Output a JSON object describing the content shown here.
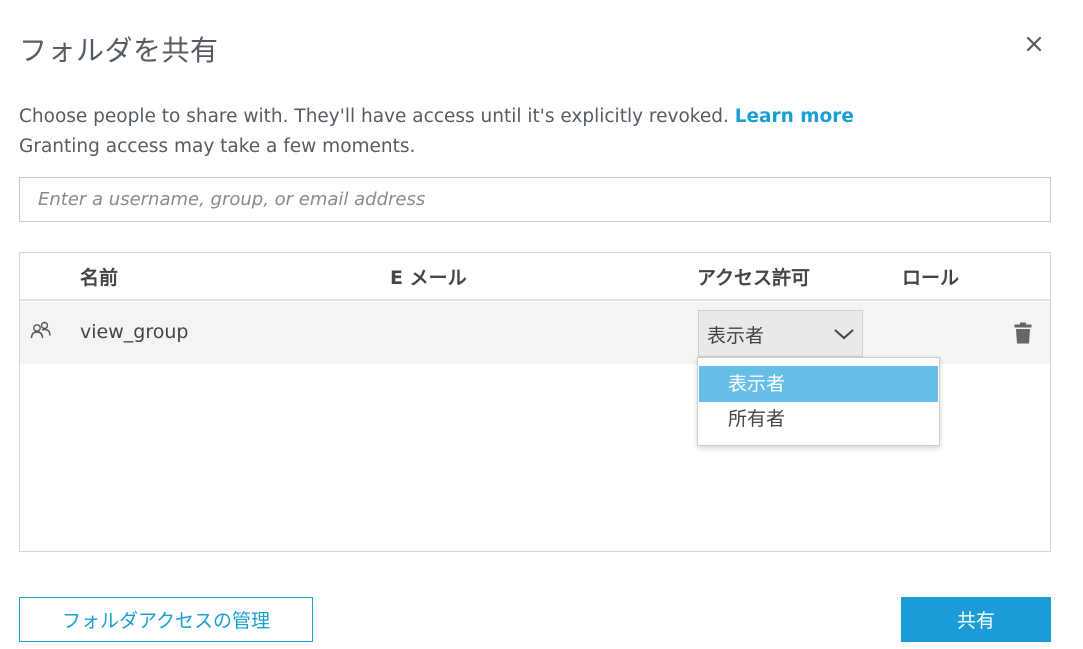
{
  "dialog": {
    "title": "フォルダを共有",
    "close_icon": "close-icon"
  },
  "description": {
    "line1": "Choose people to share with. They'll have access until it's explicitly revoked.",
    "learn_more": "Learn more",
    "line2": "Granting access may take a few moments."
  },
  "search": {
    "value": "",
    "placeholder": "Enter a username, group, or email address"
  },
  "table": {
    "headers": {
      "name": "名前",
      "email": "E メール",
      "access": "アクセス許可",
      "role": "ロール"
    },
    "rows": [
      {
        "icon": "group-icon",
        "name": "view_group",
        "email": "",
        "access": "表示者",
        "role": "",
        "delete_icon": "trash-icon"
      }
    ]
  },
  "access_dropdown": {
    "options": [
      "表示者",
      "所有者"
    ],
    "selected": "表示者"
  },
  "footer": {
    "manage_label": "フォルダアクセスの管理",
    "share_label": "共有"
  },
  "colors": {
    "accent": "#1a9fd1",
    "primary_button": "#1b9cd8",
    "selected_option": "#66bfe6",
    "title_text": "#545b64"
  }
}
